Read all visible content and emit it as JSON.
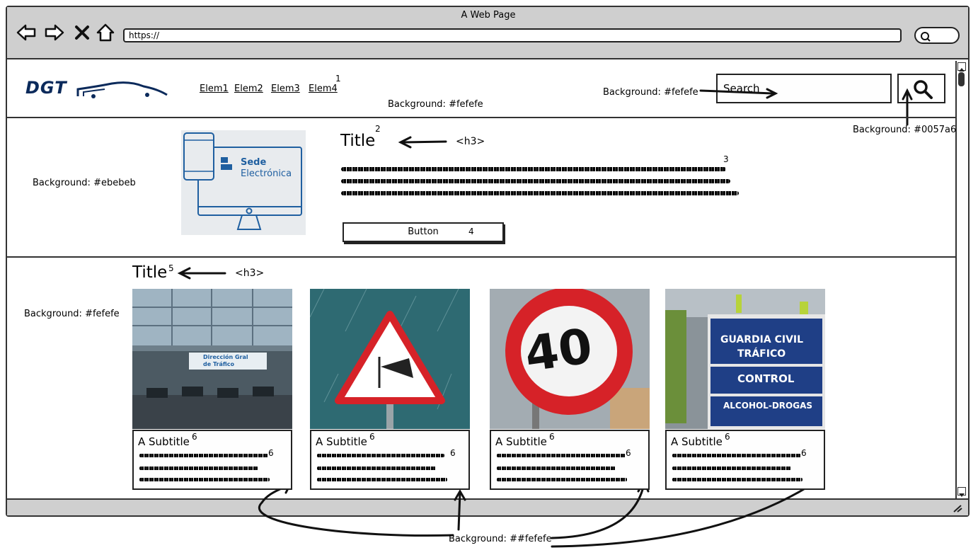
{
  "window": {
    "title": "A Web Page",
    "url": "https://"
  },
  "header": {
    "nav": [
      "Elem1",
      "Elem2",
      "Elem3",
      "Elem4"
    ],
    "nav_marker": "1",
    "bg_note": "Background: #fefefe",
    "search_note": "Background: #fefefe",
    "search_placeholder": "Search",
    "search_button_note": "Background: #0057a6"
  },
  "hero": {
    "bg_note": "Background: #ebebeb",
    "title": "Title",
    "title_marker": "2",
    "tag_note": "<h3>",
    "text_marker": "3",
    "button_label": "Button",
    "button_marker": "4",
    "sede_text_1": "Sede",
    "sede_text_2": "Electrónica"
  },
  "section": {
    "bg_note": "Background: #fefefe",
    "title": "Title",
    "title_marker": "5",
    "tag_note": "<h3>"
  },
  "cards": [
    {
      "subtitle": "A Subtitle",
      "marker": "6",
      "text_marker": "6",
      "image": "traffic-control-center"
    },
    {
      "subtitle": "A Subtitle",
      "marker": "6",
      "text_marker": "6",
      "image": "wind-warning-sign"
    },
    {
      "subtitle": "A Subtitle",
      "marker": "6",
      "text_marker": "6",
      "image": "speed-limit-40"
    },
    {
      "subtitle": "A Subtitle",
      "marker": "6",
      "text_marker": "6",
      "image": "guardia-civil-control"
    }
  ],
  "signs": {
    "speed": "40",
    "gc_line1": "GUARDIA CIVIL",
    "gc_line2": "TRÁFICO",
    "gc_line3": "CONTROL",
    "gc_line4": "ALCOHOL-DROGAS",
    "dgt_banner_1": "Dirección Gral",
    "dgt_banner_2": "de Tráfico"
  },
  "footer_note": "Background: ##fefefe",
  "logo_text": "DGT",
  "colors": {
    "brand": "#0057a6",
    "hero_bg": "#ebebeb",
    "page_bg": "#fefefe"
  }
}
